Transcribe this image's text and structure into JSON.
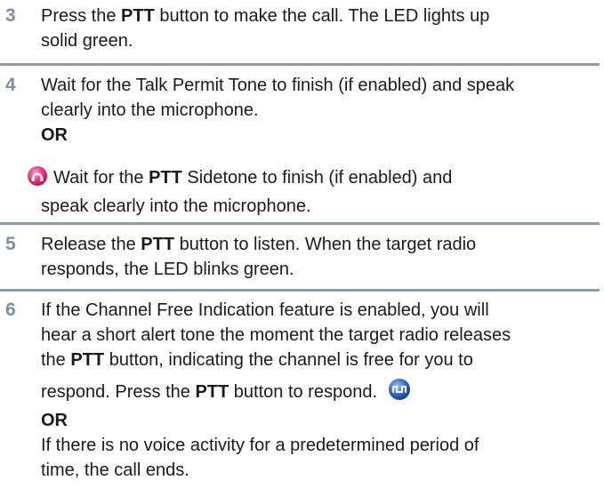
{
  "steps": [
    {
      "number": "3",
      "lines": [
        [
          "Press the ",
          "PTT",
          " button to make the call. The LED lights up"
        ],
        "solid green."
      ]
    },
    {
      "number": "4",
      "lines": [
        "Wait for the Talk Permit Tone to finish (if enabled) and speak",
        "clearly into the microphone."
      ],
      "or_label": "OR",
      "alt_icon": "sidetone-icon",
      "alt_lines": [
        [
          "Wait for the ",
          "PTT",
          " Sidetone to finish (if enabled) and"
        ],
        "speak clearly into the microphone."
      ]
    },
    {
      "number": "5",
      "lines": [
        [
          "Release the ",
          "PTT",
          " button to listen. When the target radio"
        ],
        "responds, the LED blinks green."
      ]
    },
    {
      "number": "6",
      "lines": [
        "If the Channel Free Indication feature is enabled, you will",
        "hear a short alert tone the moment the target radio releases",
        [
          "the ",
          "PTT",
          " button, indicating the channel is free for you to"
        ],
        [
          "respond. Press the ",
          "PTT",
          " button to respond."
        ]
      ],
      "inline_icon": "respond-tone-icon",
      "or_label": "OR",
      "alt_lines": [
        "If there is no voice activity for a predetermined period of",
        "time, the call ends."
      ]
    }
  ],
  "colors": {
    "step_number": "#7c8fa6",
    "divider": "#8a9bb0",
    "sidetone_icon": "#e0307a",
    "respond_icon": "#2f63c4"
  }
}
